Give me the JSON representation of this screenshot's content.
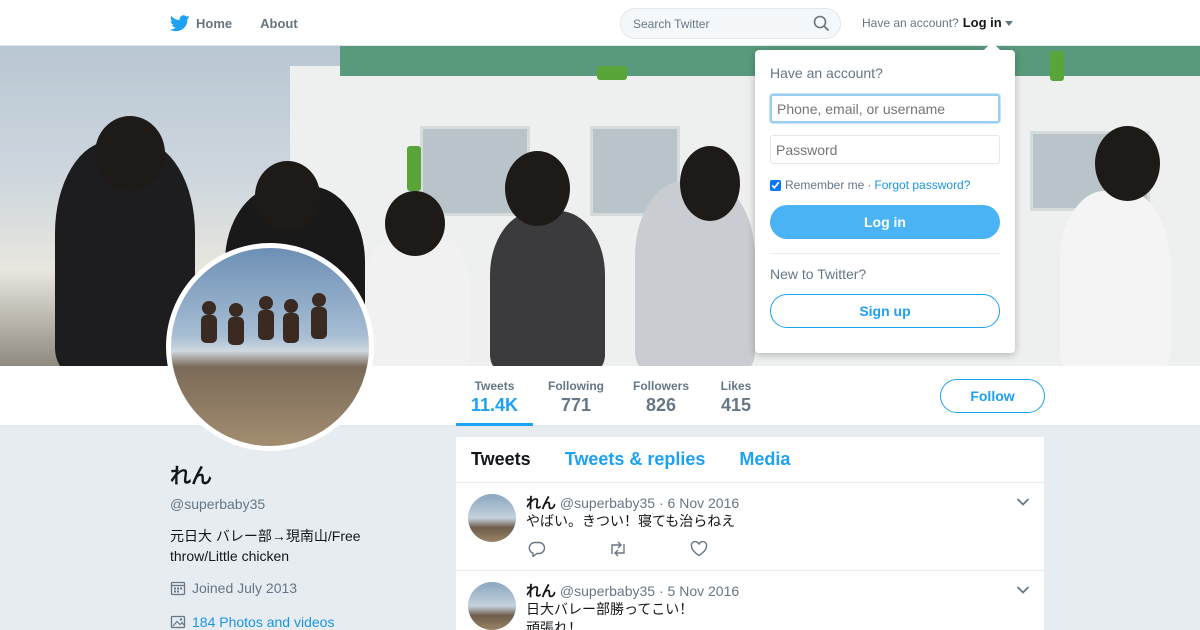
{
  "nav": {
    "logo_icon": "twitter-bird-icon",
    "home_label": "Home",
    "about_label": "About",
    "search_placeholder": "Search Twitter",
    "account_prompt": "Have an account?",
    "login_label": "Log in"
  },
  "profile": {
    "name": "れん",
    "handle": "@superbaby35",
    "bio": "元日大 バレー部→現南山/Free throw/Little chicken",
    "joined": "Joined July 2013",
    "photos_link": "184 Photos and videos",
    "follow_label": "Follow",
    "stats": [
      {
        "label": "Tweets",
        "value": "11.4K"
      },
      {
        "label": "Following",
        "value": "771"
      },
      {
        "label": "Followers",
        "value": "826"
      },
      {
        "label": "Likes",
        "value": "415"
      }
    ]
  },
  "timeline": {
    "tabs": [
      "Tweets",
      "Tweets & replies",
      "Media"
    ],
    "tweets": [
      {
        "name": "れん",
        "handle": "@superbaby35",
        "date": "6 Nov 2016",
        "text": "やばい。きつい！寝ても治らねえ"
      },
      {
        "name": "れん",
        "handle": "@superbaby35",
        "date": "5 Nov 2016",
        "text": "日大バレー部勝ってこい！",
        "text2": "頑張れ！"
      }
    ]
  },
  "login_dropdown": {
    "title": "Have an account?",
    "username_placeholder": "Phone, email, or username",
    "password_placeholder": "Password",
    "remember_label": "Remember me",
    "separator": "·",
    "forgot_label": "Forgot password?",
    "login_button": "Log in",
    "new_prompt": "New to Twitter?",
    "signup_button": "Sign up"
  },
  "colors": {
    "accent": "#1da1f2",
    "background": "#e6ecf0",
    "text": "#14171a",
    "muted": "#657786"
  }
}
